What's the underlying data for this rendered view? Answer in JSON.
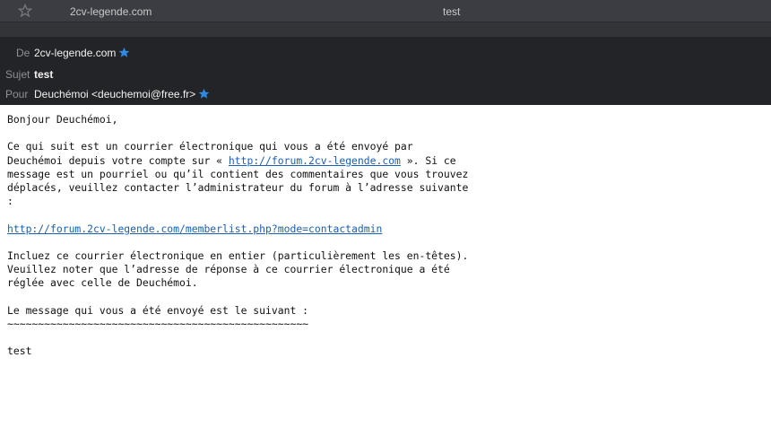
{
  "message_list": {
    "sender": "2cv-legende.com",
    "subject": "test"
  },
  "header": {
    "from_label": "De",
    "from_value": "2cv-legende.com",
    "subject_label": "Sujet",
    "subject_value": "test",
    "to_label": "Pour",
    "to_value": "Deuchémoi <deuchemoi@free.fr>"
  },
  "body": {
    "greeting": "Bonjour Deuchémoi,",
    "p1_line1": "Ce qui suit est un courrier électronique qui vous a été envoyé par",
    "p1_line2_a": "Deuchémoi depuis votre compte sur « ",
    "p1_link": "http://forum.2cv-legende.com",
    "p1_line2_b": " ». Si ce",
    "p1_line3": "message est un pourriel ou qu’il contient des commentaires que vous trouvez",
    "p1_line4": "déplacés, veuillez contacter l’administrateur du forum à l’adresse suivante",
    "p1_line5": ":",
    "contact_link": "http://forum.2cv-legende.com/memberlist.php?mode=contactadmin",
    "p2_line1": "Incluez ce courrier électronique en entier (particulièrement les en-têtes).",
    "p2_line2": "Veuillez noter que l’adresse de réponse à ce courrier électronique a été",
    "p2_line3": "réglée avec celle de Deuchémoi.",
    "p3_line1": "Le message qui vous a été envoyé est le suivant :",
    "separator": "~~~~~~~~~~~~~~~~~~~~~~~~~~~~~~~~~~~~~~~~~~~~~~~~~",
    "message": "test"
  },
  "colors": {
    "accent_star": "#2f8ae6",
    "link": "#1c5fb3",
    "header_bg": "#232427"
  }
}
